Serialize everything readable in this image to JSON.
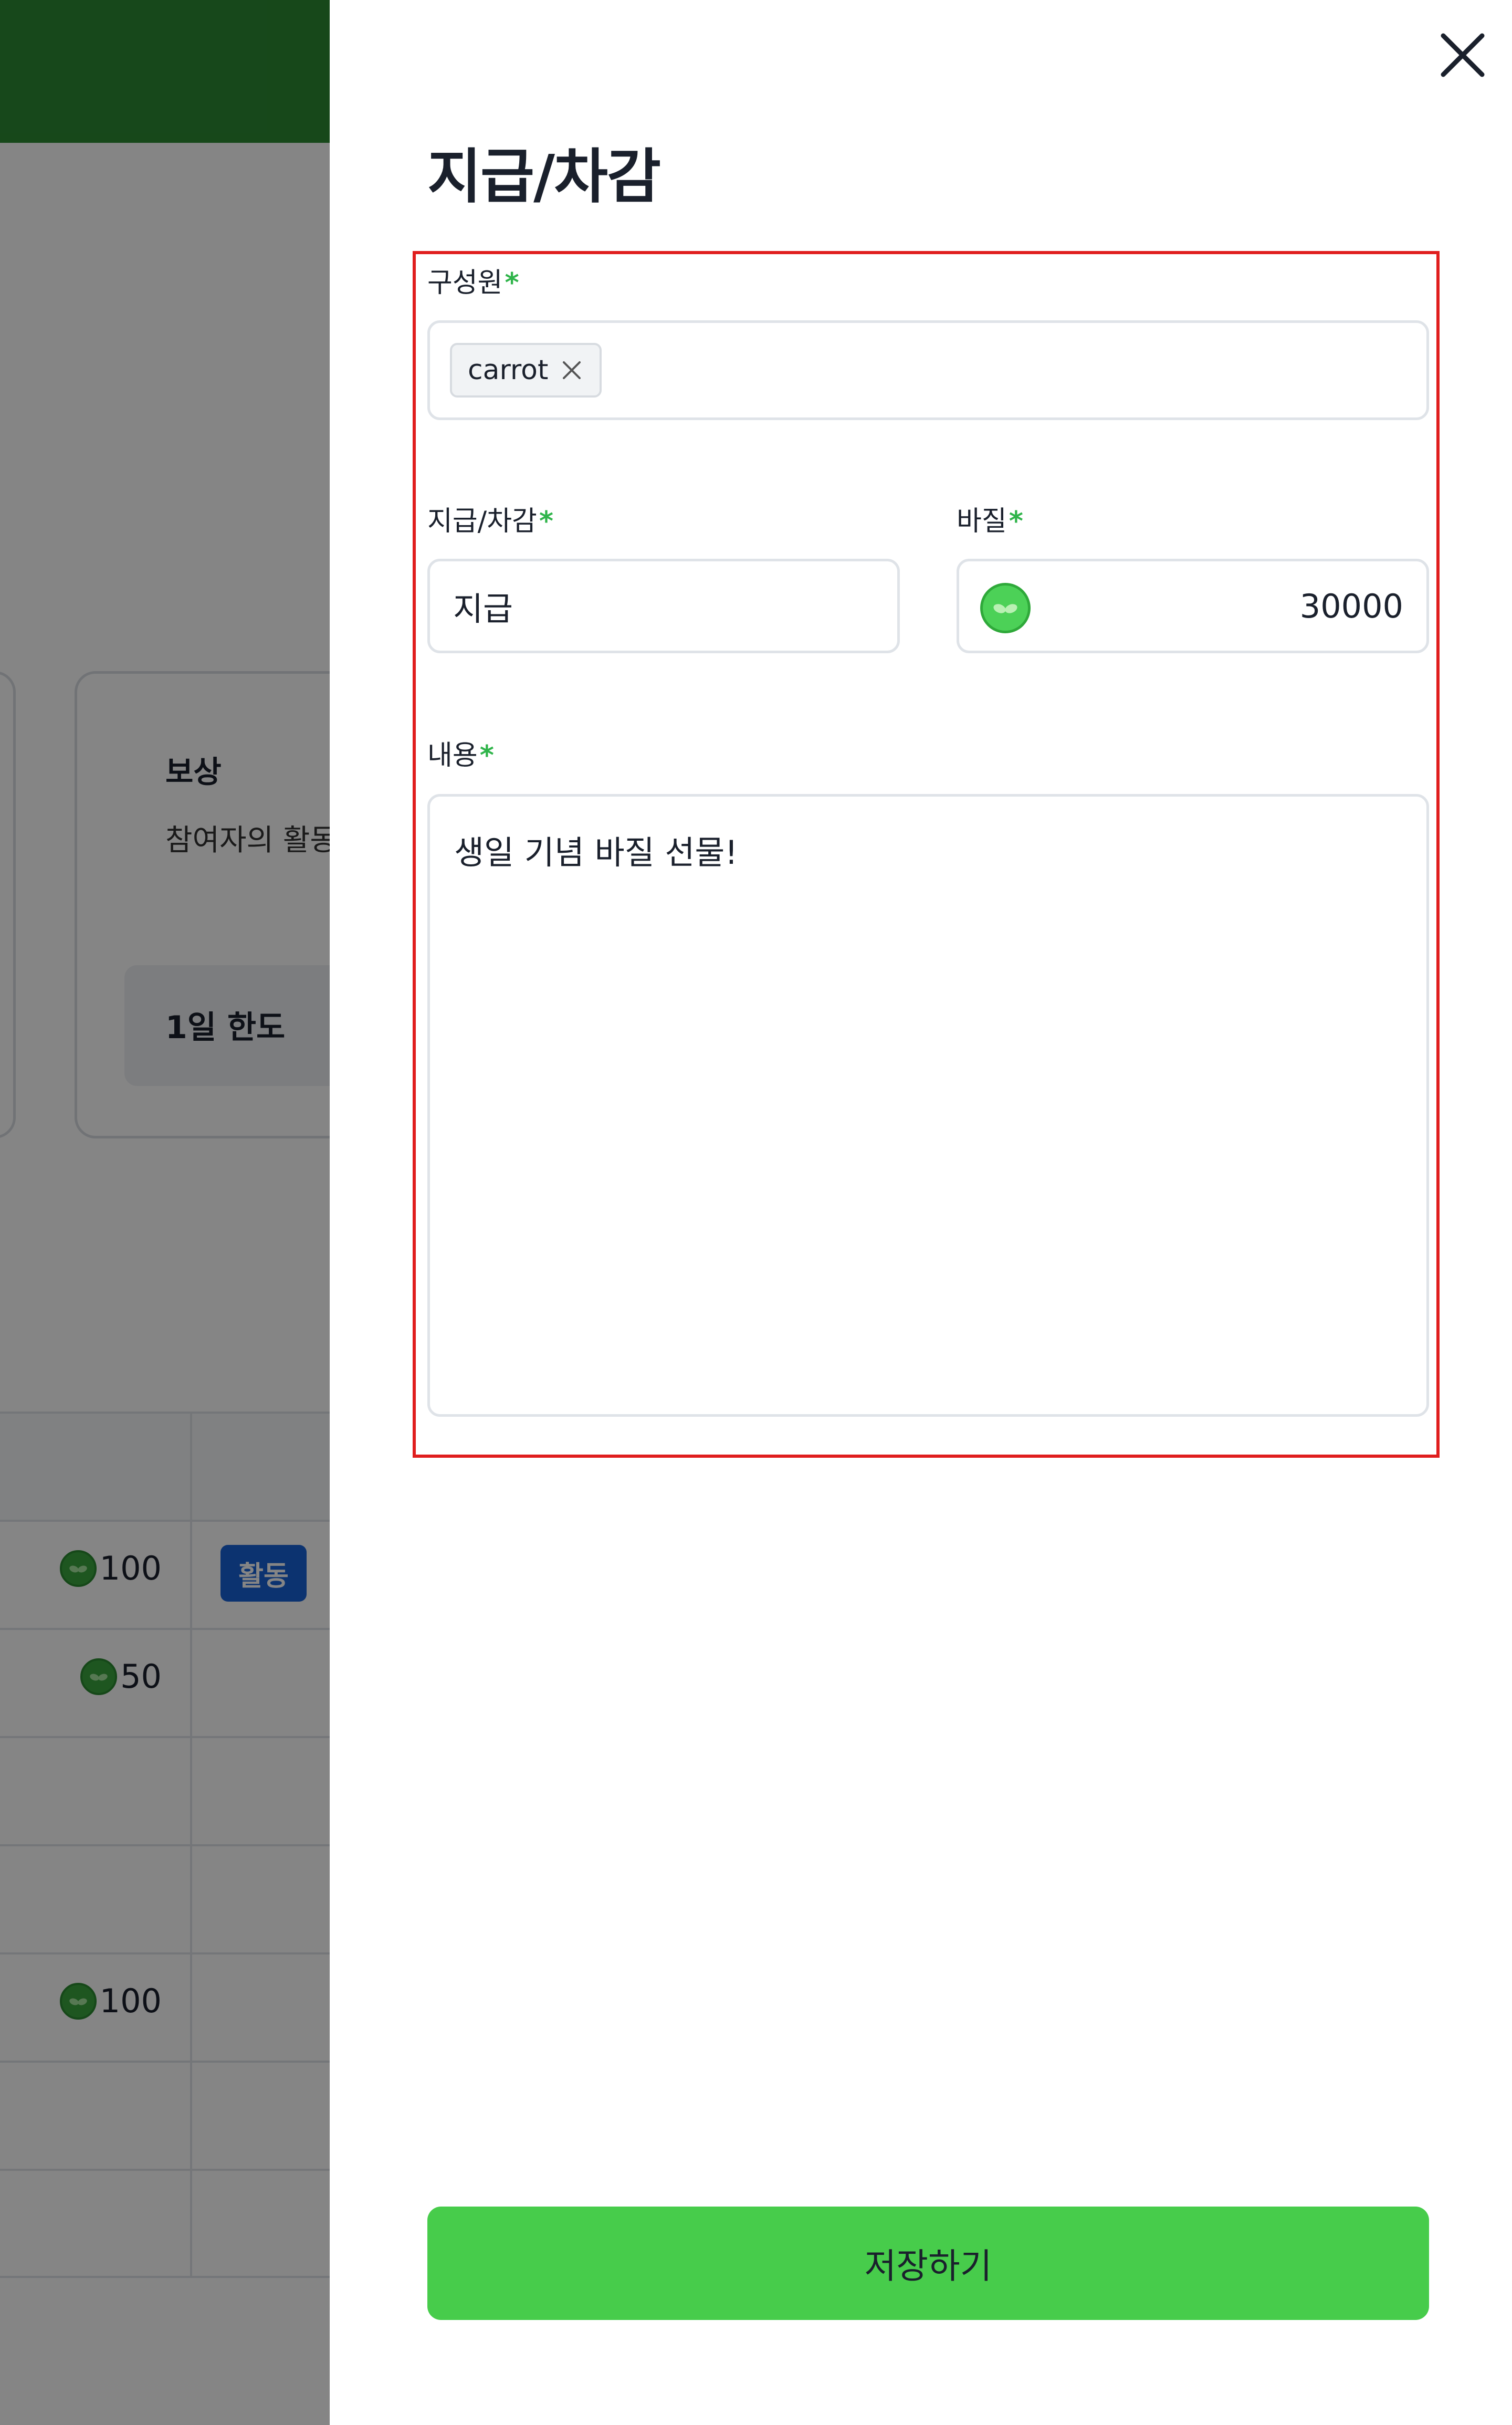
{
  "background": {
    "card": {
      "title": "보상",
      "description": "참여자의 활동",
      "limit_label": "1일 한도"
    },
    "table_rows": [
      {
        "value": "100",
        "badge": "활동"
      },
      {
        "value": "50",
        "badge": ""
      },
      {
        "value": "",
        "badge": ""
      },
      {
        "value": "",
        "badge": ""
      },
      {
        "value": "100",
        "badge": ""
      }
    ]
  },
  "drawer": {
    "title": "지급/차감",
    "close_icon": "close-icon",
    "form": {
      "members": {
        "label": "구성원",
        "required_mark": "*",
        "chips": [
          {
            "label": "carrot",
            "remove_icon": "x-icon"
          }
        ]
      },
      "type": {
        "label": "지급/차감",
        "required_mark": "*",
        "value": "지급"
      },
      "amount": {
        "label": "바질",
        "required_mark": "*",
        "coin_icon": "basil-coin-icon",
        "value": "30000"
      },
      "content": {
        "label": "내용",
        "required_mark": "*",
        "value": "생일 기념 바질 선물!"
      }
    },
    "save_label": "저장하기"
  },
  "colors": {
    "primary_green": "#47cc4b",
    "header_green": "#2d8b33",
    "required_mark": "#2fb44a",
    "highlight_border": "#e01e1e",
    "badge_blue": "#1763d6"
  }
}
